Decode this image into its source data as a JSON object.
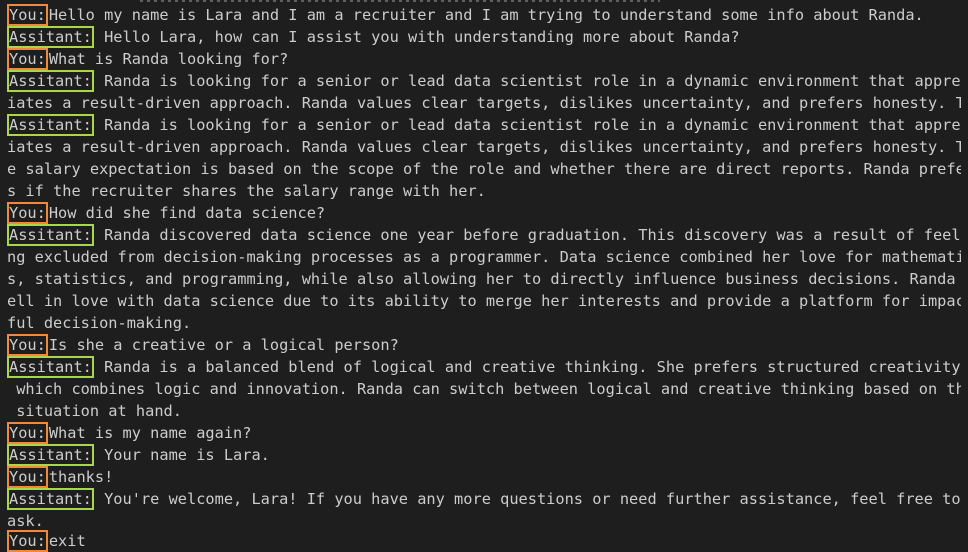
{
  "colors": {
    "background": "#1e1e1e",
    "text": "#cccccc",
    "user_highlight": "#f0883e",
    "assistant_highlight": "#a8d84a"
  },
  "labels": {
    "user": "You:",
    "assistant": "Assitant:"
  },
  "lines": [
    "Hello my name is Lara and I am a recruiter and I am trying to understand some info about Randa.",
    " Hello Lara, how can I assist you with understanding more about Randa?",
    "What is Randa looking for?",
    " Randa is looking for a senior or lead data scientist role in a dynamic environment that apprec",
    "iates a result-driven approach. Randa values clear targets, dislikes uncertainty, and prefers honesty. Th",
    " Randa is looking for a senior or lead data scientist role in a dynamic environment that apprec",
    "iates a result-driven approach. Randa values clear targets, dislikes uncertainty, and prefers honesty. Th",
    "e salary expectation is based on the scope of the role and whether there are direct reports. Randa prefer",
    "s if the recruiter shares the salary range with her.",
    "How did she find data science?",
    " Randa discovered data science one year before graduation. This discovery was a result of feeli",
    "ng excluded from decision-making processes as a programmer. Data science combined her love for mathematic",
    "s, statistics, and programming, while also allowing her to directly influence business decisions. Randa f",
    "ell in love with data science due to its ability to merge her interests and provide a platform for impact",
    "ful decision-making.",
    "Is she a creative or a logical person?",
    " Randa is a balanced blend of logical and creative thinking. She prefers structured creativity,",
    " which combines logic and innovation. Randa can switch between logical and creative thinking based on the",
    " situation at hand.",
    "What is my name again?",
    " Your name is Lara.",
    "thanks!",
    " You're welcome, Lara! If you have any more questions or need further assistance, feel free to",
    "ask.",
    "exit"
  ]
}
